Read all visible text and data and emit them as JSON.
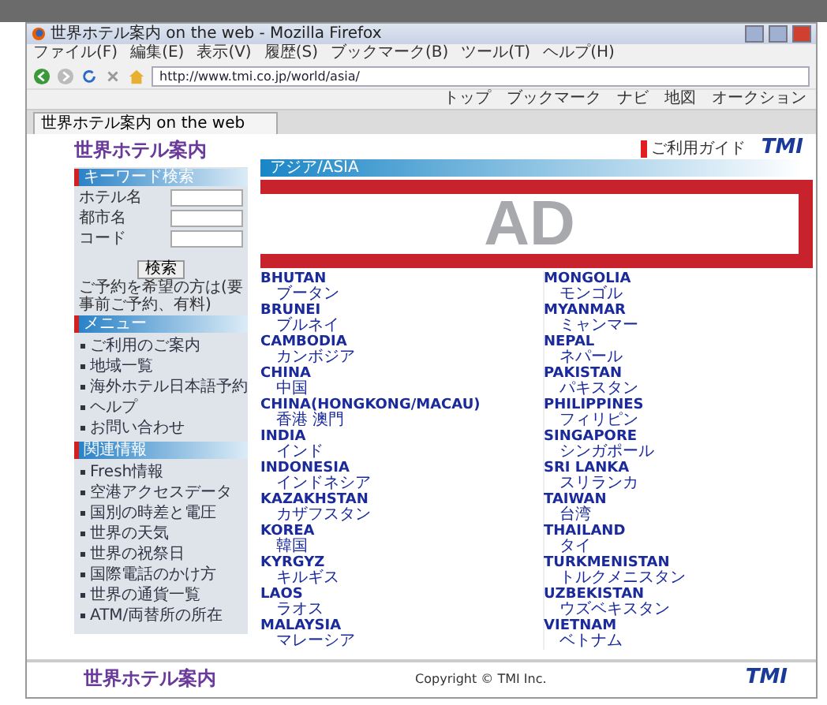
{
  "browser": {
    "title": "世界ホテル案内 on the web - Mozilla Firefox",
    "menu": [
      "ファイル(F)",
      "編集(E)",
      "表示(V)",
      "履歴(S)",
      "ブックマーク(B)",
      "ツール(T)",
      "ヘルプ(H)"
    ],
    "url": "http://www.tmi.co.jp/world/asia/",
    "bookmarks": [
      "トップ",
      "ブックマーク",
      "ナビ",
      "地図",
      "オークション"
    ],
    "tab": "世界ホテル案内 on the web"
  },
  "page": {
    "logo": "世界ホテル案内",
    "guide_link": "ご利用ガイド",
    "tmi_logo": "TMI",
    "search": {
      "title": "キーワード検索",
      "fields": [
        {
          "label": "ホテル名"
        },
        {
          "label": "都市名"
        },
        {
          "label": "コード"
        }
      ],
      "button": "検索",
      "note": "ご予約を希望の方は(要事前ご予約、有料)"
    },
    "menu": {
      "title": "メニュー",
      "items": [
        "ご利用のご案内",
        "地域一覧",
        "海外ホテル日本語予約",
        "ヘルプ",
        "お問い合わせ"
      ]
    },
    "related": {
      "title": "関連情報",
      "items": [
        "Fresh情報",
        "空港アクセスデータ",
        "国別の時差と電圧",
        "世界の天気",
        "世界の祝祭日",
        "国際電話のかけ方",
        "世界の通貨一覧",
        "ATM/両替所の所在"
      ]
    },
    "breadcrumb": "アジア/ASIA",
    "ad": "AD",
    "columns": [
      [
        {
          "en": "BHUTAN",
          "ja": "ブータン"
        },
        {
          "en": "BRUNEI",
          "ja": "ブルネイ"
        },
        {
          "en": "CAMBODIA",
          "ja": "カンボジア"
        },
        {
          "en": "CHINA",
          "ja": "中国"
        },
        {
          "en": "CHINA(HONGKONG/MACAU)",
          "ja": "香港 澳門"
        },
        {
          "en": "INDIA",
          "ja": "インド"
        },
        {
          "en": "INDONESIA",
          "ja": "インドネシア"
        },
        {
          "en": "KAZAKHSTAN",
          "ja": "カザフスタン"
        },
        {
          "en": "KOREA",
          "ja": "韓国"
        },
        {
          "en": "KYRGYZ",
          "ja": "キルギス"
        },
        {
          "en": "LAOS",
          "ja": "ラオス"
        },
        {
          "en": "MALAYSIA",
          "ja": "マレーシア"
        }
      ],
      [
        {
          "en": "MONGOLIA",
          "ja": "モンゴル"
        },
        {
          "en": "MYANMAR",
          "ja": "ミャンマー"
        },
        {
          "en": "NEPAL",
          "ja": "ネパール"
        },
        {
          "en": "PAKISTAN",
          "ja": "パキスタン"
        },
        {
          "en": "PHILIPPINES",
          "ja": "フィリピン"
        },
        {
          "en": "SINGAPORE",
          "ja": "シンガポール"
        },
        {
          "en": "SRI LANKA",
          "ja": "スリランカ"
        },
        {
          "en": "TAIWAN",
          "ja": "台湾"
        },
        {
          "en": "THAILAND",
          "ja": "タイ"
        },
        {
          "en": "TURKMENISTAN",
          "ja": "トルクメニスタン"
        },
        {
          "en": "UZBEKISTAN",
          "ja": "ウズベキスタン"
        },
        {
          "en": "VIETNAM",
          "ja": "ベトナム"
        }
      ]
    ],
    "footer": {
      "copyright": "Copyright © TMI Inc.",
      "logo": "世界ホテル案内",
      "tmi_logo": "TMI"
    }
  }
}
